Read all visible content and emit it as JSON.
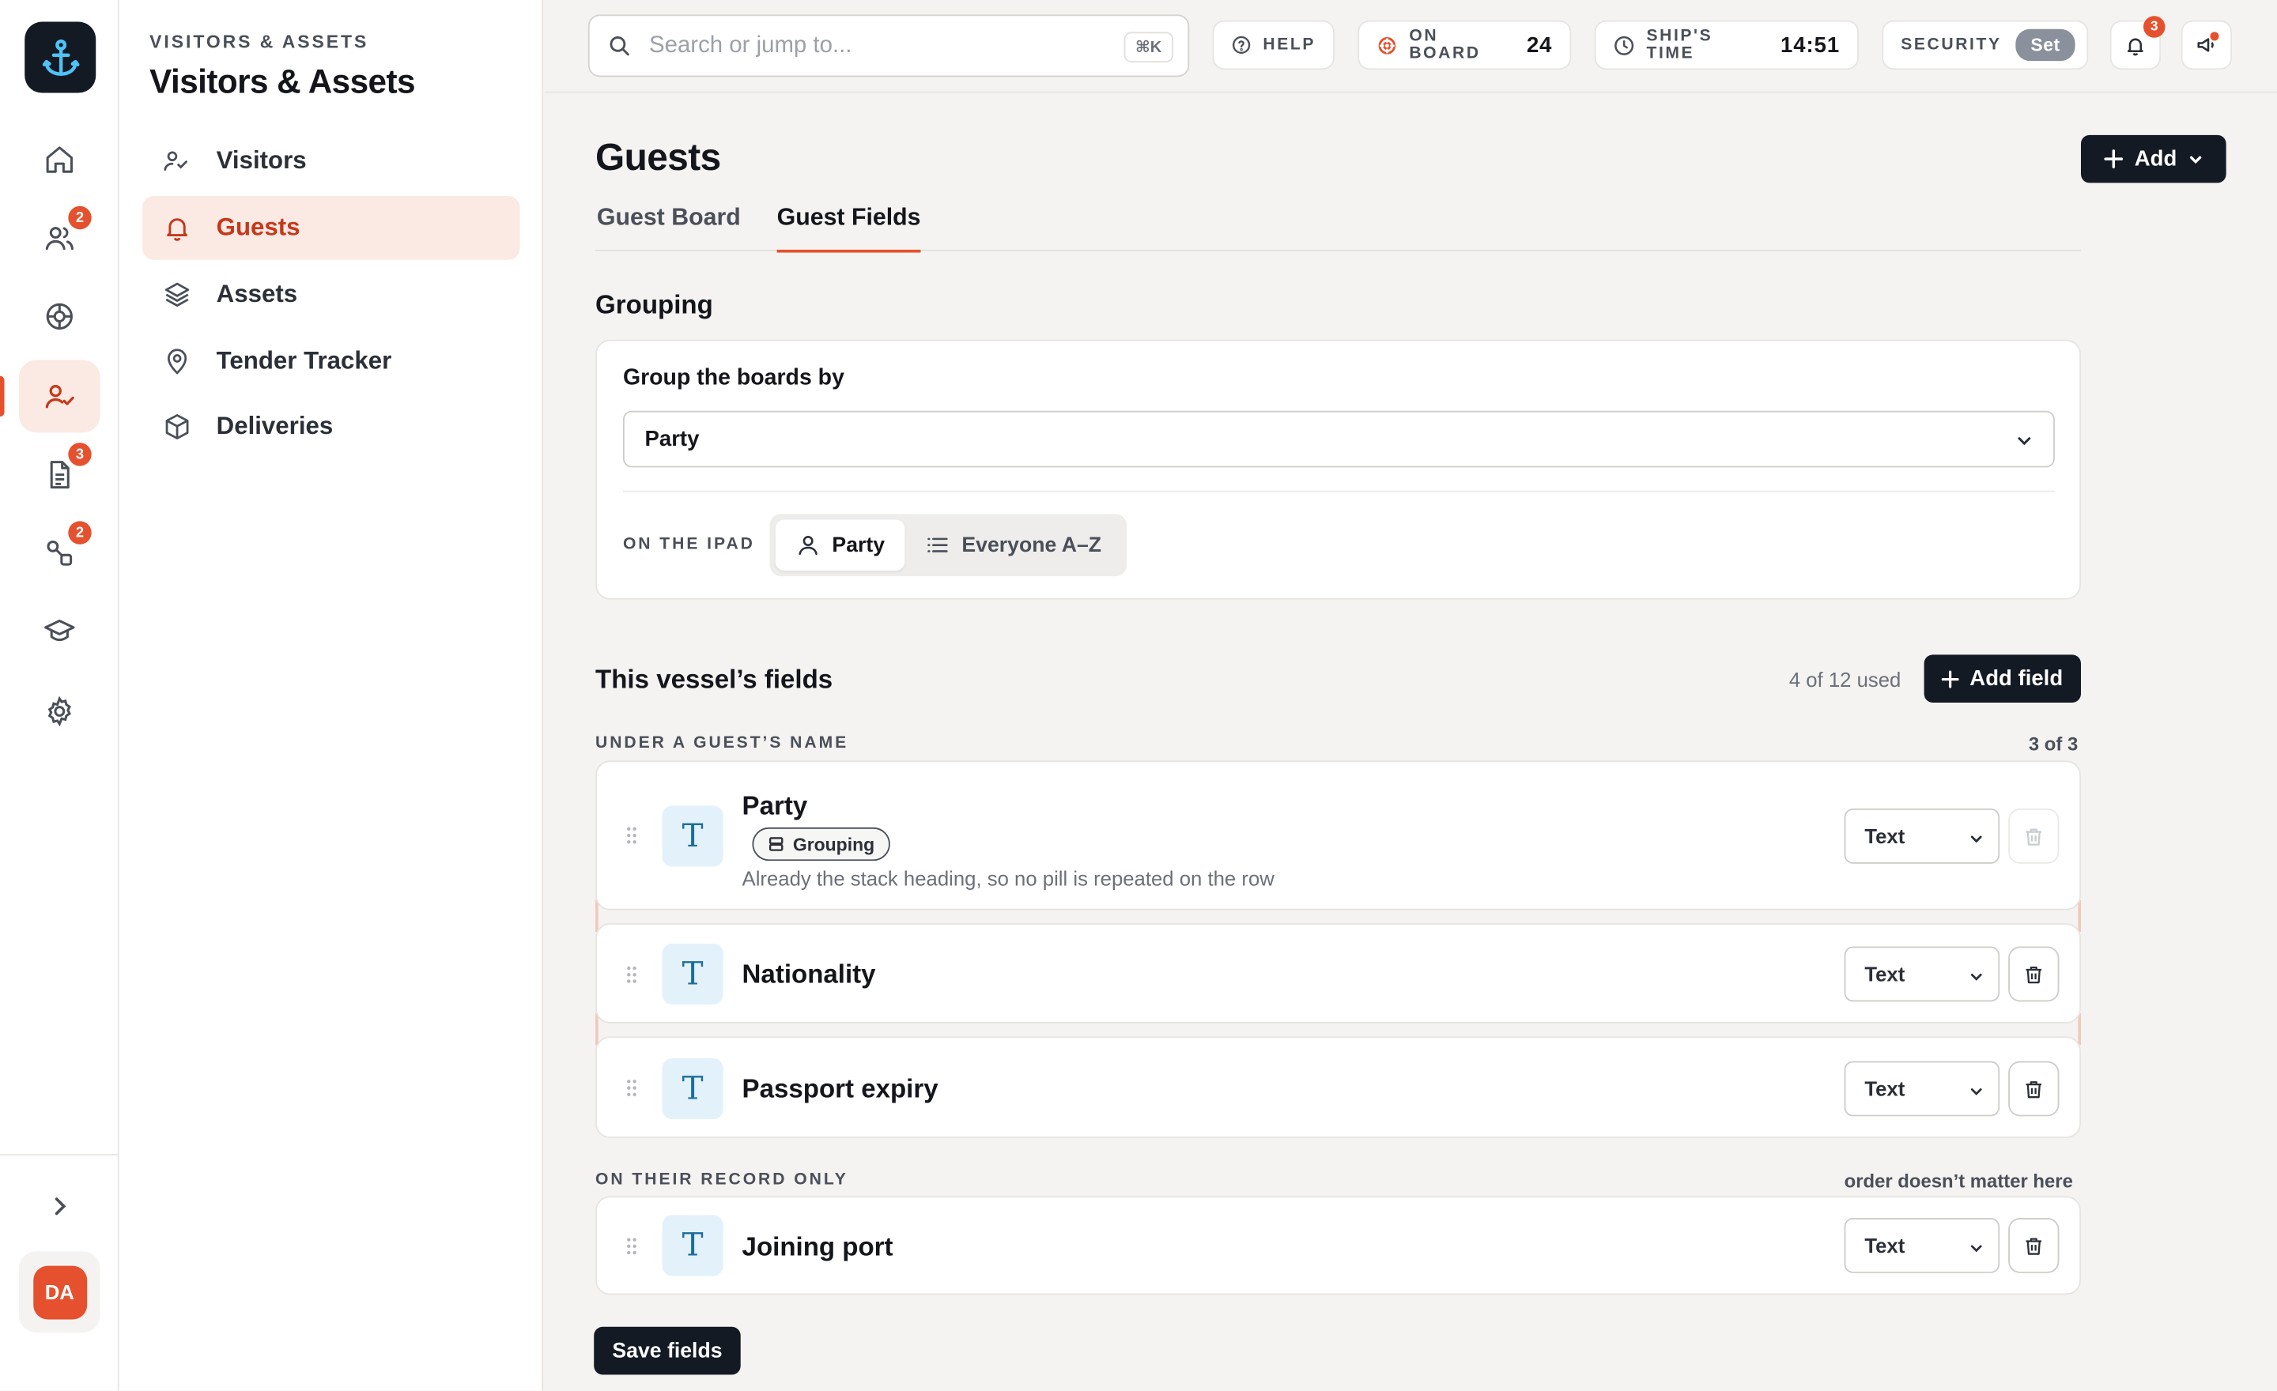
{
  "rail": {
    "badges": {
      "people": "2",
      "documents": "3",
      "workflows": "2"
    },
    "avatar_initials": "DA"
  },
  "sidebar": {
    "eyebrow": "VISITORS & ASSETS",
    "title": "Visitors & Assets",
    "items": [
      {
        "label": "Visitors",
        "icon": "user-check-icon"
      },
      {
        "label": "Guests",
        "icon": "bell-icon",
        "active": true
      },
      {
        "label": "Assets",
        "icon": "layers-icon"
      },
      {
        "label": "Tender Tracker",
        "icon": "map-pin-icon"
      },
      {
        "label": "Deliveries",
        "icon": "box-icon"
      }
    ]
  },
  "topbar": {
    "search_placeholder": "Search or jump to...",
    "search_shortcut": "⌘K",
    "help_label": "HELP",
    "onboard_label": "ON BOARD",
    "onboard_count": "24",
    "shiptime_label": "SHIP'S TIME",
    "shiptime_value": "14:51",
    "security_label": "SECURITY",
    "security_action": "Set",
    "notifications_count": "3"
  },
  "main": {
    "title": "Guests",
    "add_label": "Add",
    "tabs": [
      {
        "label": "Guest Board",
        "active": false
      },
      {
        "label": "Guest Fields",
        "active": true
      }
    ],
    "grouping": {
      "heading": "Grouping",
      "label": "Group the boards by",
      "selected": "Party",
      "ipad_label": "ON THE IPAD",
      "ipad_options": [
        {
          "label": "Party",
          "selected": true
        },
        {
          "label": "Everyone A–Z",
          "selected": false
        }
      ]
    },
    "fields": {
      "heading": "This vessel’s fields",
      "usage": "4 of 12 used",
      "add_field_label": "Add field",
      "under_name": {
        "eyebrow": "UNDER A GUEST’S NAME",
        "count": "3 of 3",
        "rows": [
          {
            "name": "Party",
            "chip": "Grouping",
            "hint": "Already the stack heading, so no pill is repeated on the row",
            "type": "Text"
          },
          {
            "name": "Nationality",
            "type": "Text"
          },
          {
            "name": "Passport expiry",
            "type": "Text"
          }
        ]
      },
      "record_only": {
        "eyebrow": "ON THEIR RECORD ONLY",
        "note": "order doesn’t matter here",
        "rows": [
          {
            "name": "Joining port",
            "type": "Text"
          }
        ]
      }
    },
    "save_label": "Save fields"
  },
  "colors": {
    "accent": "#e5512e",
    "dark": "#141a24",
    "active_bg": "#fbe9e4"
  }
}
